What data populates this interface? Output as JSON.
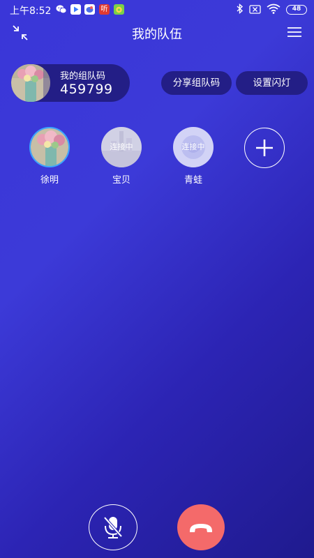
{
  "status_bar": {
    "time": "上午8:52",
    "apps": [
      "wechat-icon",
      "video-app-icon",
      "chat-app-icon",
      "listen-app-icon",
      "game-app-icon"
    ],
    "listen_glyph": "听",
    "battery": "48",
    "right_icons": [
      "bluetooth-icon",
      "no-sim-icon",
      "wifi-icon",
      "battery-icon"
    ]
  },
  "header": {
    "title": "我的队伍"
  },
  "team_code": {
    "label": "我的组队码",
    "value": "459799"
  },
  "actions": {
    "share_label": "分享组队码",
    "flash_label": "设置闪灯"
  },
  "members": [
    {
      "name": "徐明",
      "status": ""
    },
    {
      "name": "宝贝",
      "status": "连接中"
    },
    {
      "name": "青蛙",
      "status": "连接中"
    }
  ],
  "colors": {
    "background_start": "#3a36d8",
    "background_end": "#1f1a8e",
    "pill": "#231e86",
    "hangup": "#f46a6a",
    "active_ring": "#3aa8ff"
  }
}
